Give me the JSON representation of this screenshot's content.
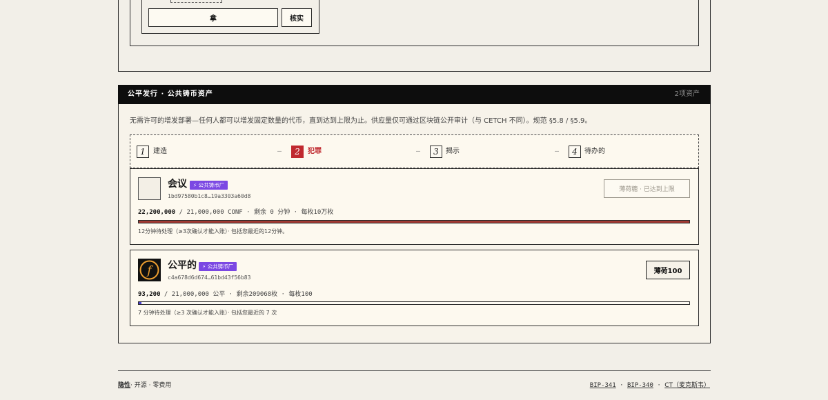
{
  "previous_form": {
    "take_label": "拿",
    "verify_label": "核实"
  },
  "panel": {
    "title": "公平发行 · 公共铸币资产",
    "count": "2项资产",
    "description": "无需许可的增发部署—任何人都可以增发固定数量的代币，直到达到上限为止。供应量仅可通过区块链公开审计（与 CETCH 不同）。规范 §5.8 / §5.9。"
  },
  "steps": [
    {
      "num": "1",
      "label": "建造",
      "active": false
    },
    {
      "num": "2",
      "label": "犯罪",
      "active": true
    },
    {
      "num": "3",
      "label": "揭示",
      "active": false
    },
    {
      "num": "4",
      "label": "待办的",
      "active": false
    }
  ],
  "step_separator": "—",
  "assets": [
    {
      "name": "会议",
      "badge": "⚡ 公共铸币厂",
      "hash": "1bd97580b1c8…19a3303a60d8",
      "minted": "22,200,000",
      "supply_rest": " / 21,000,000 CONF  ·  剩余 0 分钟  ·  每枚10万枚",
      "progress": 1.0,
      "bar_color": "#a13a33",
      "note": "12分钟待处理（≥3次确认才能入账）· 包括您最近的12分钟。",
      "action": "薄荷糖 · 已达到上限",
      "action_enabled": false,
      "icon": "blank-avatar"
    },
    {
      "name": "公平的",
      "badge": "⚡ 公共铸币厂",
      "hash": "c4a678d6d674…61bd43f56b83",
      "minted": "93,200",
      "supply_rest": " / 21,000,000 公平  ·  剩余209068枚  ·  每枚100",
      "progress": 0.0044,
      "bar_color": "#4a3fd0",
      "note": "7 分钟待处理（≥3 次确认才能入账）· 包括您最近的 7 次",
      "action": "薄荷100",
      "action_enabled": true,
      "icon": "f-coin-icon",
      "icon_letter": "f"
    }
  ],
  "footer": {
    "privacy": "隐性",
    "open_source": "开源",
    "zero_fee": "零费用",
    "sep": "·",
    "links": [
      "BIP-341",
      "BIP-340",
      "CT（麦克斯韦）"
    ]
  }
}
